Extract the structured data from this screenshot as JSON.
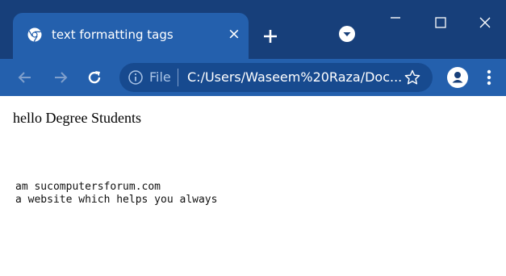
{
  "browser": {
    "tab": {
      "title": "text formatting tags",
      "close_glyph": "×"
    },
    "toolbar": {
      "security_label": "File",
      "url": "C:/Users/Waseem%20Raza/Doc..."
    },
    "colors": {
      "titlebar": "#173f7a",
      "active_tab": "#2460ad",
      "omnibox": "#174a8f"
    },
    "icons": [
      "chrome-favicon",
      "new-tab-plus",
      "profile-dropdown",
      "minimize",
      "maximize",
      "close",
      "back-arrow",
      "forward-arrow",
      "reload",
      "info",
      "star",
      "avatar",
      "kebab-menu"
    ]
  },
  "page": {
    "heading": "hello Degree Students",
    "pre_lines": [
      "am sucomputersforum.com",
      "a website which helps you always"
    ]
  }
}
